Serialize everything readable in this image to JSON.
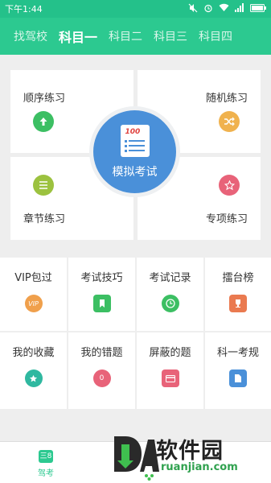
{
  "status_bar": {
    "time": "下午1:44",
    "battery": "▮"
  },
  "tabs": [
    {
      "label": "找驾校",
      "active": false
    },
    {
      "label": "科目一",
      "active": true
    },
    {
      "label": "科目二",
      "active": false
    },
    {
      "label": "科目三",
      "active": false
    },
    {
      "label": "科目四",
      "active": false
    }
  ],
  "practice": {
    "sequential": "顺序练习",
    "random": "随机练习",
    "chapter": "章节练习",
    "special": "专项练习",
    "mock_exam": "模拟考试",
    "mock_badge": "100"
  },
  "grid": {
    "vip": {
      "label": "VIP包过",
      "icon_text": "VIP"
    },
    "tips": "考试技巧",
    "records": "考试记录",
    "ranking": "擂台榜",
    "favorites": "我的收藏",
    "mistakes": {
      "label": "我的错题",
      "icon_text": "0"
    },
    "hidden": "屏蔽的题",
    "rules": "科一考规"
  },
  "bottom_nav": {
    "label": "驾考",
    "icon_text": "三8"
  },
  "watermark": {
    "letters": "DA",
    "cn": "软件园",
    "url": "ruanjian.com"
  },
  "colors": {
    "brand_green": "#2cc990",
    "center_blue": "#4a90d9"
  }
}
